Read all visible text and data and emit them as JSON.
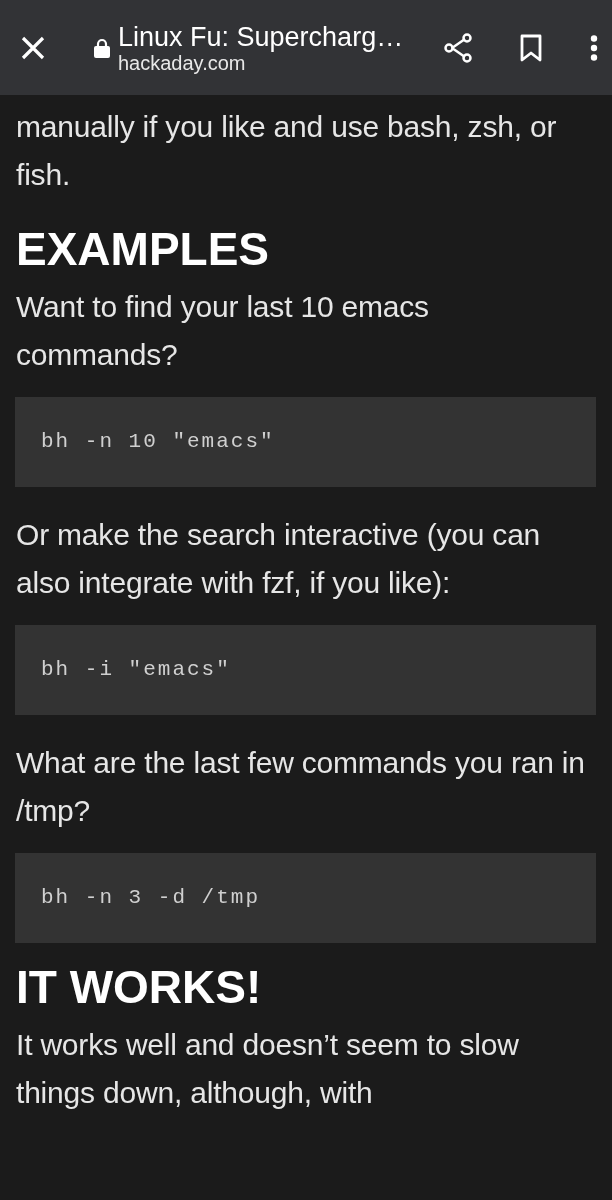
{
  "toolbar": {
    "title": "Linux Fu: Supercharg…",
    "domain": "hackaday.com"
  },
  "article": [
    {
      "kind": "paragraph",
      "text": "manually if you like and use bash, zsh, or fish."
    },
    {
      "kind": "heading",
      "text": "EXAMPLES"
    },
    {
      "kind": "paragraph",
      "text": "Want to find your last 10 emacs commands?"
    },
    {
      "kind": "code",
      "text": "bh -n 10 \"emacs\""
    },
    {
      "kind": "paragraph",
      "text": "Or make the search interactive (you can also integrate with fzf, if you like):"
    },
    {
      "kind": "code",
      "text": "bh -i \"emacs\""
    },
    {
      "kind": "paragraph",
      "text": "What are the last few commands you ran in /tmp?"
    },
    {
      "kind": "code",
      "text": "bh -n 3 -d /tmp"
    },
    {
      "kind": "heading",
      "text": "IT WORKS!"
    },
    {
      "kind": "paragraph",
      "text": "It works well and doesn’t seem to slow things down, although, with"
    }
  ]
}
